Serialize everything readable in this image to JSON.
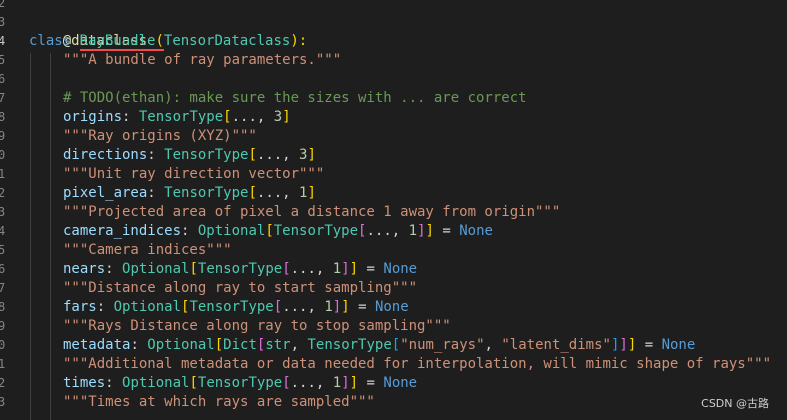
{
  "gutter": {
    "line_numbers": [
      "2",
      "3",
      "4",
      "5",
      "6",
      "7",
      "8",
      "9",
      "0",
      "1",
      "2",
      "3",
      "4",
      "5",
      "6",
      "7",
      "8",
      "9",
      "0",
      "1",
      "2",
      "3"
    ]
  },
  "code": {
    "decorator": "@dataclass",
    "class_kw": "class",
    "class_name": "RayBundle",
    "open_paren": "(",
    "base_class": "TensorDataclass",
    "close_paren_colon": "):",
    "class_doc": "\"\"\"A bundle of ray parameters.\"\"\"",
    "todo_comment": "# TODO(ethan): make sure the sizes with ... are correct",
    "fields": {
      "origins_name": "origins",
      "origins_type": "TensorType",
      "origins_args": "..., ",
      "origins_num": "3",
      "origins_doc": "\"\"\"Ray origins (XYZ)\"\"\"",
      "directions_name": "directions",
      "directions_type": "TensorType",
      "directions_args": "..., ",
      "directions_num": "3",
      "directions_doc": "\"\"\"Unit ray direction vector\"\"\"",
      "pixel_area_name": "pixel_area",
      "pixel_area_type": "TensorType",
      "pixel_area_args": "..., ",
      "pixel_area_num": "1",
      "pixel_area_doc": "\"\"\"Projected area of pixel a distance 1 away from origin\"\"\"",
      "camera_indices_name": "camera_indices",
      "camera_indices_optional": "Optional",
      "camera_indices_type": "TensorType",
      "camera_indices_args": "..., ",
      "camera_indices_num": "1",
      "camera_indices_default": "None",
      "camera_indices_doc": "\"\"\"Camera indices\"\"\"",
      "nears_name": "nears",
      "nears_optional": "Optional",
      "nears_type": "TensorType",
      "nears_args": "..., ",
      "nears_num": "1",
      "nears_default": "None",
      "nears_doc": "\"\"\"Distance along ray to start sampling\"\"\"",
      "fars_name": "fars",
      "fars_optional": "Optional",
      "fars_type": "TensorType",
      "fars_args": "..., ",
      "fars_num": "1",
      "fars_default": "None",
      "fars_doc": "\"\"\"Rays Distance along ray to stop sampling\"\"\"",
      "metadata_name": "metadata",
      "metadata_optional": "Optional",
      "metadata_dict": "Dict",
      "metadata_str": "str",
      "metadata_type": "TensorType",
      "metadata_key1": "\"num_rays\"",
      "metadata_key2": "\"latent_dims\"",
      "metadata_default": "None",
      "metadata_doc": "\"\"\"Additional metadata or data needed for interpolation, will mimic shape of rays\"\"\"",
      "times_name": "times",
      "times_optional": "Optional",
      "times_type": "TensorType",
      "times_args": "..., ",
      "times_num": "1",
      "times_default": "None",
      "times_doc": "\"\"\"Times at which rays are sampled\"\"\""
    }
  },
  "watermark": "CSDN @古路"
}
